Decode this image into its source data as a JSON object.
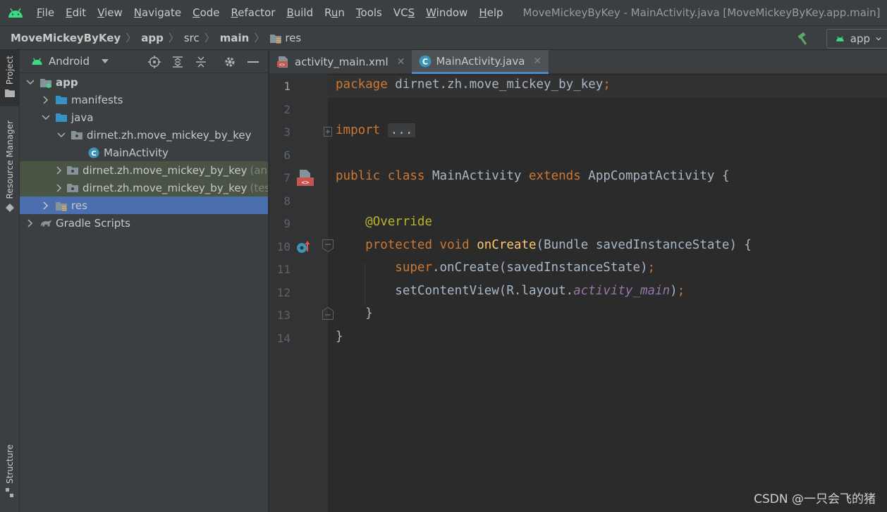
{
  "menu": {
    "items": [
      {
        "label": "File",
        "u": "F",
        "rest": "ile"
      },
      {
        "label": "Edit",
        "u": "E",
        "rest": "dit"
      },
      {
        "label": "View",
        "u": "V",
        "rest": "iew"
      },
      {
        "label": "Navigate",
        "u": "N",
        "rest": "avigate"
      },
      {
        "label": "Code",
        "u": "C",
        "rest": "ode"
      },
      {
        "label": "Refactor",
        "u": "R",
        "rest": "efactor"
      },
      {
        "label": "Build",
        "u": "B",
        "rest": "uild"
      },
      {
        "label": "Run",
        "u": "",
        "pre": "R",
        "u2": "u",
        "rest": "n"
      },
      {
        "label": "Tools",
        "u": "T",
        "rest": "ools"
      },
      {
        "label": "VCS",
        "u": "",
        "pre": "VC",
        "u2": "S",
        "rest": ""
      },
      {
        "label": "Window",
        "u": "W",
        "rest": "indow"
      },
      {
        "label": "Help",
        "u": "H",
        "rest": "elp"
      }
    ],
    "window_title": "MoveMickeyByKey - MainActivity.java [MoveMickeyByKey.app.main]"
  },
  "breadcrumb": {
    "project": "MoveMickeyByKey",
    "module": "app",
    "src": "src",
    "main": "main",
    "res": "res"
  },
  "run_config": {
    "label": "app"
  },
  "toolstrip": {
    "project": "Project",
    "resource_manager": "Resource Manager",
    "structure": "Structure"
  },
  "project_panel": {
    "view_mode": "Android",
    "tree": [
      {
        "label": "app",
        "bold": true
      },
      {
        "label": "manifests"
      },
      {
        "label": "java"
      },
      {
        "label": "dirnet.zh.move_mickey_by_key"
      },
      {
        "label": "MainActivity"
      },
      {
        "label": "dirnet.zh.move_mickey_by_key",
        "suffix": "(androidTest)"
      },
      {
        "label": "dirnet.zh.move_mickey_by_key",
        "suffix": "(test)"
      },
      {
        "label": "res"
      },
      {
        "label": "Gradle Scripts"
      }
    ]
  },
  "editor": {
    "tabs": [
      {
        "label": "activity_main.xml",
        "active": false
      },
      {
        "label": "MainActivity.java",
        "active": true
      }
    ],
    "line_numbers": [
      "1",
      "2",
      "3",
      "6",
      "7",
      "8",
      "9",
      "10",
      "11",
      "12",
      "13",
      "14"
    ],
    "code": {
      "l1_kw": "package",
      "l1_pkg": " dirnet.zh.move_mickey_by_key",
      "l1_semi": ";",
      "l3_kw": "import",
      "l3_fold": "...",
      "l7_kw1": "public",
      "l7_kw2": "class",
      "l7_name": "MainActivity",
      "l7_kw3": "extends",
      "l7_super": "AppCompatActivity {",
      "l9_ann": "@Override",
      "l10_kw1": "protected",
      "l10_kw2": "void",
      "l10_fn": "onCreate",
      "l10_params": "(Bundle savedInstanceState) {",
      "l11_kw": "super",
      "l11_rest": ".onCreate(savedInstanceState)",
      "l11_semi": ";",
      "l12_call": "setContentView(R.layout.",
      "l12_field": "activity_main",
      "l12_close": ")",
      "l12_semi": ";",
      "l13_brace": "}",
      "l14_brace": "}"
    }
  },
  "watermark": "CSDN @一只会飞的猪"
}
